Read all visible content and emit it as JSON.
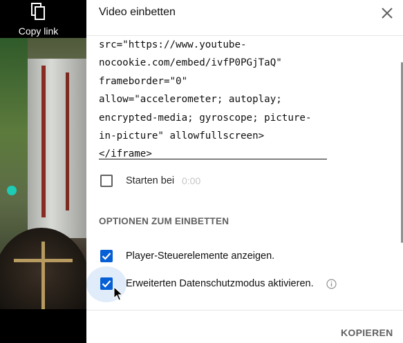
{
  "share": {
    "copy_link_label": "Copy link",
    "copy_icon": "copy-icon"
  },
  "dialog": {
    "title": "Video einbetten",
    "close_icon": "close-icon",
    "embed_code": "src=\"https://www.youtube-\nnocookie.com/embed/ivfP0PGjTaQ\"\nframeborder=\"0\"\nallow=\"accelerometer; autoplay;\nencrypted-media; gyroscope; picture-\nin-picture\" allowfullscreen>\n</iframe>",
    "start_at": {
      "label": "Starten bei",
      "time": "0:00",
      "checked": false
    },
    "options_heading": "OPTIONEN ZUM EINBETTEN",
    "options": [
      {
        "label": "Player-Steuerelemente anzeigen.",
        "checked": true
      },
      {
        "label": "Erweiterten Datenschutzmodus aktivieren.",
        "checked": true,
        "info_icon": "info-icon"
      }
    ],
    "copy_button": "KOPIEREN"
  },
  "colors": {
    "accent": "#065fd4",
    "text": "#0f0f0f",
    "muted": "#606060"
  }
}
